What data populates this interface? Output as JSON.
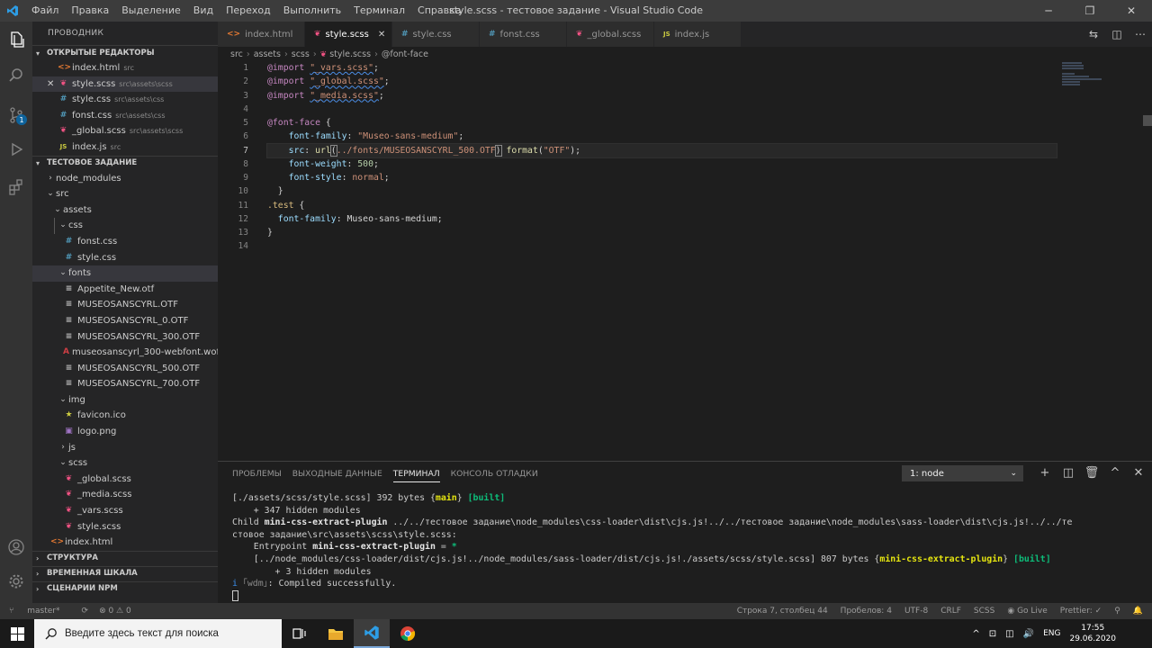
{
  "titlebar": {
    "menu": [
      "Файл",
      "Правка",
      "Выделение",
      "Вид",
      "Переход",
      "Выполнить",
      "Терминал",
      "Справка"
    ],
    "title": "style.scss - тестовое задание - Visual Studio Code",
    "controls": [
      "─",
      "❐",
      "✕"
    ]
  },
  "activity": {
    "badge": "1"
  },
  "sidebar": {
    "title": "ПРОВОДНИК",
    "open_editors_label": "ОТКРЫТЫЕ РЕДАКТОРЫ",
    "open_editors": [
      {
        "icon": "<>",
        "name": "index.html",
        "desc": "src"
      },
      {
        "icon": "❦",
        "name": "style.scss",
        "desc": "src\\assets\\scss"
      },
      {
        "icon": "#",
        "name": "style.css",
        "desc": "src\\assets\\css"
      },
      {
        "icon": "#",
        "name": "fonst.css",
        "desc": "src\\assets\\css"
      },
      {
        "icon": "❦",
        "name": "_global.scss",
        "desc": "src\\assets\\scss"
      },
      {
        "icon": "JS",
        "name": "index.js",
        "desc": "src"
      }
    ],
    "close_glyph": "✕",
    "project_label": "ТЕСТОВОЕ ЗАДАНИЕ",
    "tree": {
      "node_modules": "node_modules",
      "src": "src",
      "assets": "assets",
      "css": "css",
      "css_files": [
        {
          "icon": "#",
          "name": "fonst.css"
        },
        {
          "icon": "#",
          "name": "style.css"
        }
      ],
      "fonts": "fonts",
      "font_files": [
        {
          "icon": "≡",
          "name": "Appetite_New.otf"
        },
        {
          "icon": "≡",
          "name": "MUSEOSANSCYRL.OTF"
        },
        {
          "icon": "≡",
          "name": "MUSEOSANSCYRL_0.OTF"
        },
        {
          "icon": "≡",
          "name": "MUSEOSANSCYRL_300.OTF"
        },
        {
          "icon": "A",
          "name": "museosanscyrl_300-webfont.woff"
        },
        {
          "icon": "≡",
          "name": "MUSEOSANSCYRL_500.OTF"
        },
        {
          "icon": "≡",
          "name": "MUSEOSANSCYRL_700.OTF"
        }
      ],
      "img": "img",
      "img_files": [
        {
          "icon": "★",
          "name": "favicon.ico"
        },
        {
          "icon": "▣",
          "name": "logo.png"
        }
      ],
      "js": "js",
      "scss": "scss",
      "scss_files": [
        {
          "icon": "❦",
          "name": "_global.scss"
        },
        {
          "icon": "❦",
          "name": "_media.scss"
        },
        {
          "icon": "❦",
          "name": "_vars.scss"
        },
        {
          "icon": "❦",
          "name": "style.scss"
        }
      ],
      "index_html": {
        "icon": "<>",
        "name": "index.html"
      }
    },
    "bottom_sections": [
      "СТРУКТУРА",
      "ВРЕМЕННАЯ ШКАЛА",
      "СЦЕНАРИИ NPM"
    ]
  },
  "tabs": [
    {
      "icon": "<>",
      "label": "index.html"
    },
    {
      "icon": "❦",
      "label": "style.scss",
      "close": "✕"
    },
    {
      "icon": "#",
      "label": "style.css"
    },
    {
      "icon": "#",
      "label": "fonst.css"
    },
    {
      "icon": "❦",
      "label": "_global.scss"
    },
    {
      "icon": "JS",
      "label": "index.js"
    }
  ],
  "editor_actions": [
    "⇆",
    "◫",
    "⋯"
  ],
  "breadcrumb": [
    "src",
    "assets",
    "scss",
    "style.scss",
    "@font-face"
  ],
  "breadcrumb_sep": "›",
  "editor": {
    "line_numbers": [
      "1",
      "2",
      "3",
      "4",
      "5",
      "6",
      "7",
      "8",
      "9",
      "10",
      "11",
      "12",
      "13",
      "14"
    ],
    "l1_kw": "@import",
    "l1_str": "\"_vars.scss\"",
    "l2_kw": "@import",
    "l2_str": "\"_global.scss\"",
    "l3_kw": "@import",
    "l3_str": "\"_media.scss\"",
    "l5_kw": "@font-face",
    "l6_prop": "font-family",
    "l6_val": "\"Museo-sans-medium\"",
    "l7_prop": "src",
    "l7_fn": "url",
    "l7_path": "../fonts/MUSEOSANSCYRL_500.OTF",
    "l7_fn2": "format",
    "l7_fmt": "\"OTF\"",
    "l8_prop": "font-weight",
    "l8_val": "500",
    "l9_prop": "font-style",
    "l9_val": "normal",
    "l11_sel": ".test",
    "l12_prop": "font-family",
    "l12_val": "Museo-sans-medium"
  },
  "panel": {
    "tabs": [
      "ПРОБЛЕМЫ",
      "ВЫХОДНЫЕ ДАННЫЕ",
      "ТЕРМИНАЛ",
      "КОНСОЛЬ ОТЛАДКИ"
    ],
    "terminal_select": "1: node",
    "actions": [
      "+",
      "◫",
      "🗑",
      "^",
      "✕"
    ],
    "lines": {
      "l1_a": "[./assets/scss/style.scss] 392 bytes {",
      "l1_b": "main",
      "l1_c": "} ",
      "l1_d": "[built]",
      "l2": "    + 347 hidden modules",
      "l3_a": "Child ",
      "l3_b": "mini-css-extract-plugin",
      "l3_c": " ../../тестовое задание\\node_modules\\css-loader\\dist\\cjs.js!../../тестовое задание\\node_modules\\sass-loader\\dist\\cjs.js!../../те",
      "l4": "стовое задание\\src\\assets\\scss\\style.scss:",
      "l5_a": "    Entrypoint ",
      "l5_b": "mini-css-extract-plugin",
      "l5_c": " = ",
      "l5_d": "*",
      "l6_a": "    [../node_modules/css-loader/dist/cjs.js!../node_modules/sass-loader/dist/cjs.js!./assets/scss/style.scss] 807 bytes {",
      "l6_b": "mini-css-extract-plugin",
      "l6_c": "} ",
      "l6_d": "[built]",
      "l7": "        + 3 hidden modules",
      "l8_a": "i ",
      "l8_b": "｢wdm｣",
      "l8_c": ": Compiled successfully."
    }
  },
  "statusbar": {
    "branch": "master*",
    "sync": "⟳",
    "problems": "⊗ 0 ⚠ 0",
    "right": [
      "Строка 7, столбец 44",
      "Пробелов: 4",
      "UTF-8",
      "CRLF",
      "SCSS",
      "◉ Go Live",
      "Prettier: ✓",
      "⚲",
      "🔔"
    ]
  },
  "taskbar": {
    "search_placeholder": "Введите здесь текст для поиска",
    "lang": "ENG",
    "time": "17:55",
    "date": "29.06.2020",
    "tray_icons": [
      "^",
      "⊡",
      "◫",
      "🔊"
    ]
  }
}
